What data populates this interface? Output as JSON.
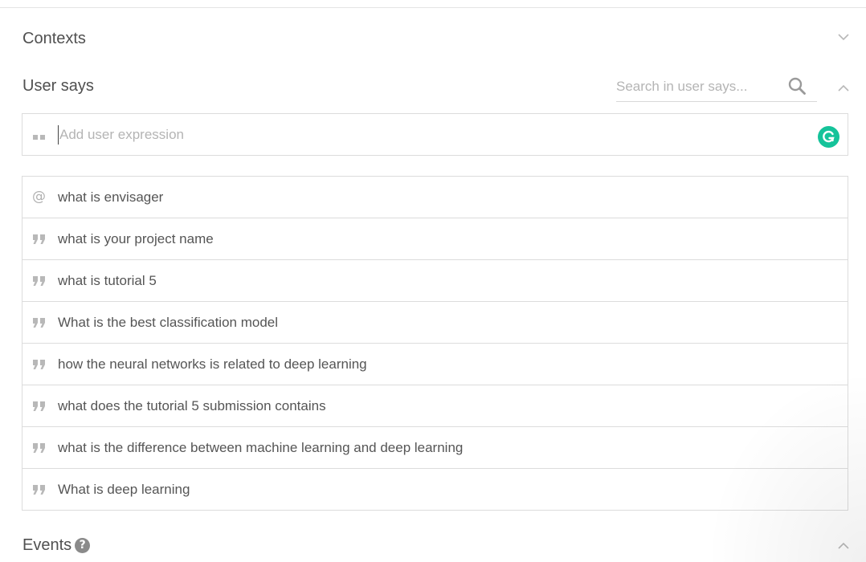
{
  "contexts": {
    "title": "Contexts",
    "toggle_icon": "chevron-down-icon"
  },
  "user_says": {
    "title": "User says",
    "search_placeholder": "Search in user says...",
    "toggle_icon": "chevron-up-icon",
    "add_placeholder": "Add user expression",
    "expressions": [
      {
        "type": "template",
        "icon": "at-icon",
        "text": "what is envisager"
      },
      {
        "type": "example",
        "icon": "quote-icon",
        "text": "what is your project name"
      },
      {
        "type": "example",
        "icon": "quote-icon",
        "text": "what is tutorial 5"
      },
      {
        "type": "example",
        "icon": "quote-icon",
        "text": "What is the best classification model"
      },
      {
        "type": "example",
        "icon": "quote-icon",
        "text": "how the neural networks is related to deep learning"
      },
      {
        "type": "example",
        "icon": "quote-icon",
        "text": "what does the tutorial 5 submission contains"
      },
      {
        "type": "example",
        "icon": "quote-icon",
        "text": "what is the difference between machine learning and deep learning"
      },
      {
        "type": "example",
        "icon": "quote-icon",
        "text": "What is deep learning"
      }
    ]
  },
  "events": {
    "title": "Events",
    "help_icon": "question-circle-icon",
    "help_glyph": "?",
    "toggle_icon": "chevron-up-icon"
  },
  "colors": {
    "grammarly": "#15c39a",
    "border": "#dcdcdc",
    "text": "#555555",
    "placeholder": "#b4b4b4"
  }
}
